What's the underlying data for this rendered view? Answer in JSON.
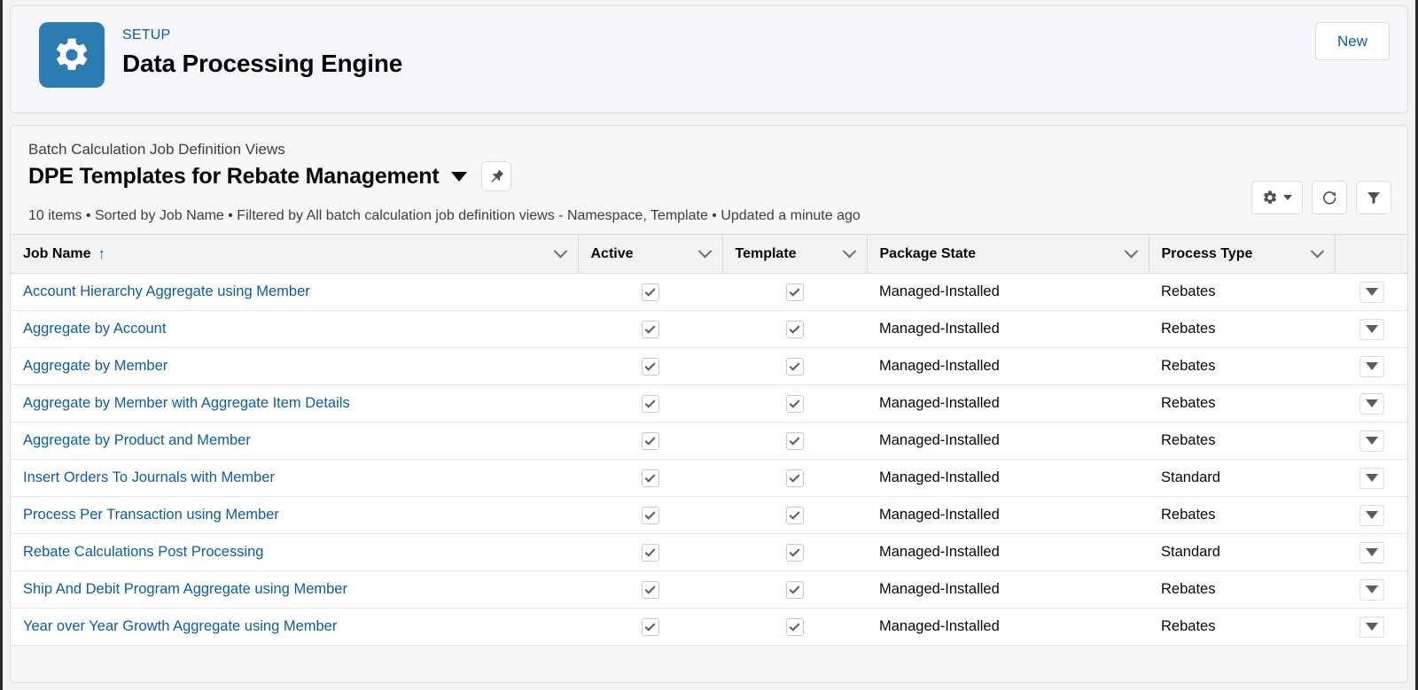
{
  "header": {
    "eyebrow": "SETUP",
    "title": "Data Processing Engine",
    "app_icon": "gear-icon",
    "new_label": "New",
    "icon_bg": "#2c7bb1"
  },
  "listview": {
    "breadcrumb": "Batch Calculation Job Definition Views",
    "title": "DPE Templates for Rebate Management",
    "meta": "10 items • Sorted by Job Name • Filtered by All batch calculation job definition views - Namespace, Template • Updated a minute ago",
    "pin_icon": "pin-icon",
    "settings_icon": "gear-icon",
    "refresh_icon": "refresh-icon",
    "filter_icon": "filter-icon"
  },
  "table": {
    "columns": [
      {
        "label": "Job Name",
        "sorted": "ascending",
        "sort_glyph": "↑"
      },
      {
        "label": "Active"
      },
      {
        "label": "Template"
      },
      {
        "label": "Package State"
      },
      {
        "label": "Process Type"
      }
    ],
    "rows": [
      {
        "job_name": "Account Hierarchy Aggregate using Member",
        "active": true,
        "template": true,
        "package_state": "Managed-Installed",
        "process_type": "Rebates"
      },
      {
        "job_name": "Aggregate by Account",
        "active": true,
        "template": true,
        "package_state": "Managed-Installed",
        "process_type": "Rebates"
      },
      {
        "job_name": "Aggregate by Member",
        "active": true,
        "template": true,
        "package_state": "Managed-Installed",
        "process_type": "Rebates"
      },
      {
        "job_name": "Aggregate by Member with Aggregate Item Details",
        "active": true,
        "template": true,
        "package_state": "Managed-Installed",
        "process_type": "Rebates"
      },
      {
        "job_name": "Aggregate by Product and Member",
        "active": true,
        "template": true,
        "package_state": "Managed-Installed",
        "process_type": "Rebates"
      },
      {
        "job_name": "Insert Orders To Journals with Member",
        "active": true,
        "template": true,
        "package_state": "Managed-Installed",
        "process_type": "Standard"
      },
      {
        "job_name": "Process Per Transaction using Member",
        "active": true,
        "template": true,
        "package_state": "Managed-Installed",
        "process_type": "Rebates"
      },
      {
        "job_name": "Rebate Calculations Post Processing",
        "active": true,
        "template": true,
        "package_state": "Managed-Installed",
        "process_type": "Standard"
      },
      {
        "job_name": "Ship And Debit Program Aggregate using Member",
        "active": true,
        "template": true,
        "package_state": "Managed-Installed",
        "process_type": "Rebates"
      },
      {
        "job_name": "Year over Year Growth Aggregate using Member",
        "active": true,
        "template": true,
        "package_state": "Managed-Installed",
        "process_type": "Rebates"
      }
    ]
  },
  "colors": {
    "link": "#0b5cab",
    "page_bg": "#f3f3f3",
    "header_row_bg": "#f3f3f3"
  }
}
